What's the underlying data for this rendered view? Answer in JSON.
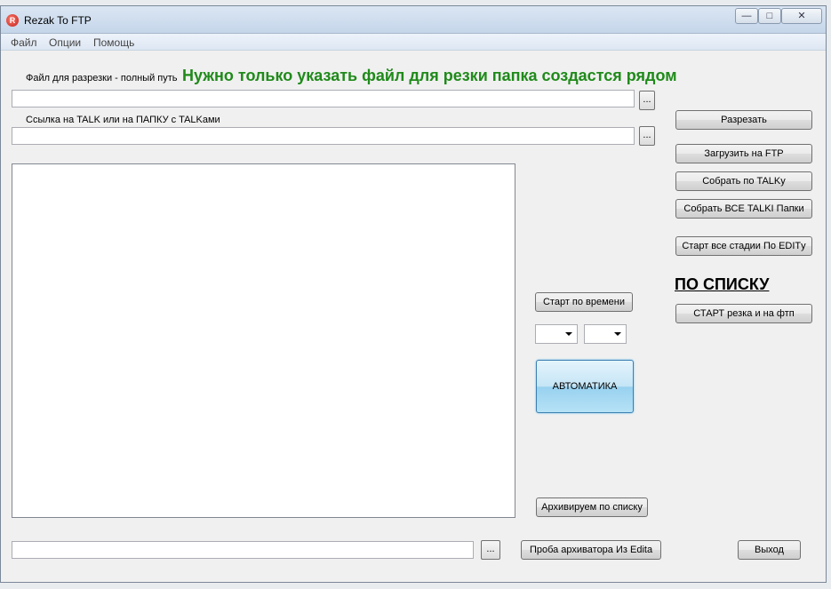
{
  "window": {
    "title": "Rezak To FTP",
    "controls": {
      "minimize": "—",
      "maximize": "□",
      "close": "✕"
    }
  },
  "menu": [
    "Файл",
    "Опции",
    "Помощь"
  ],
  "form": {
    "file_label": "Файл для разрезки - полный путь",
    "hint_banner": "Нужно только указать файл для резки папка создастся рядом",
    "file_value": "",
    "talk_label": "Ссылка на TALK  или на ПАПКУ с TALKами",
    "talk_value": "",
    "archive_value": "",
    "browse_label": "..."
  },
  "buttons": {
    "cut": "Разрезать",
    "upload_ftp": "Загрузить на FTP",
    "collect_talk": "Собрать по TALKу",
    "collect_all_talk": "Собрать ВСЕ TALKI Папки",
    "start_all_stages": "Старт все стадии По EDITу",
    "start_cut_ftp": "СТАРТ резка и на фтп",
    "start_by_time": "Старт по времени",
    "automatic": "АВТОМАТИКА",
    "archive_by_list": "Архивируем по списку",
    "test_archiver": "Проба архиватора Из Edita",
    "exit": "Выход"
  },
  "list_heading": "ПО СПИСКУ",
  "dropdowns": {
    "hour_selected": "",
    "minute_selected": ""
  },
  "colors": {
    "banner": "#1f8a1a",
    "automatic_button": "#98d1ef",
    "titlebar": "#c5d6ea"
  }
}
